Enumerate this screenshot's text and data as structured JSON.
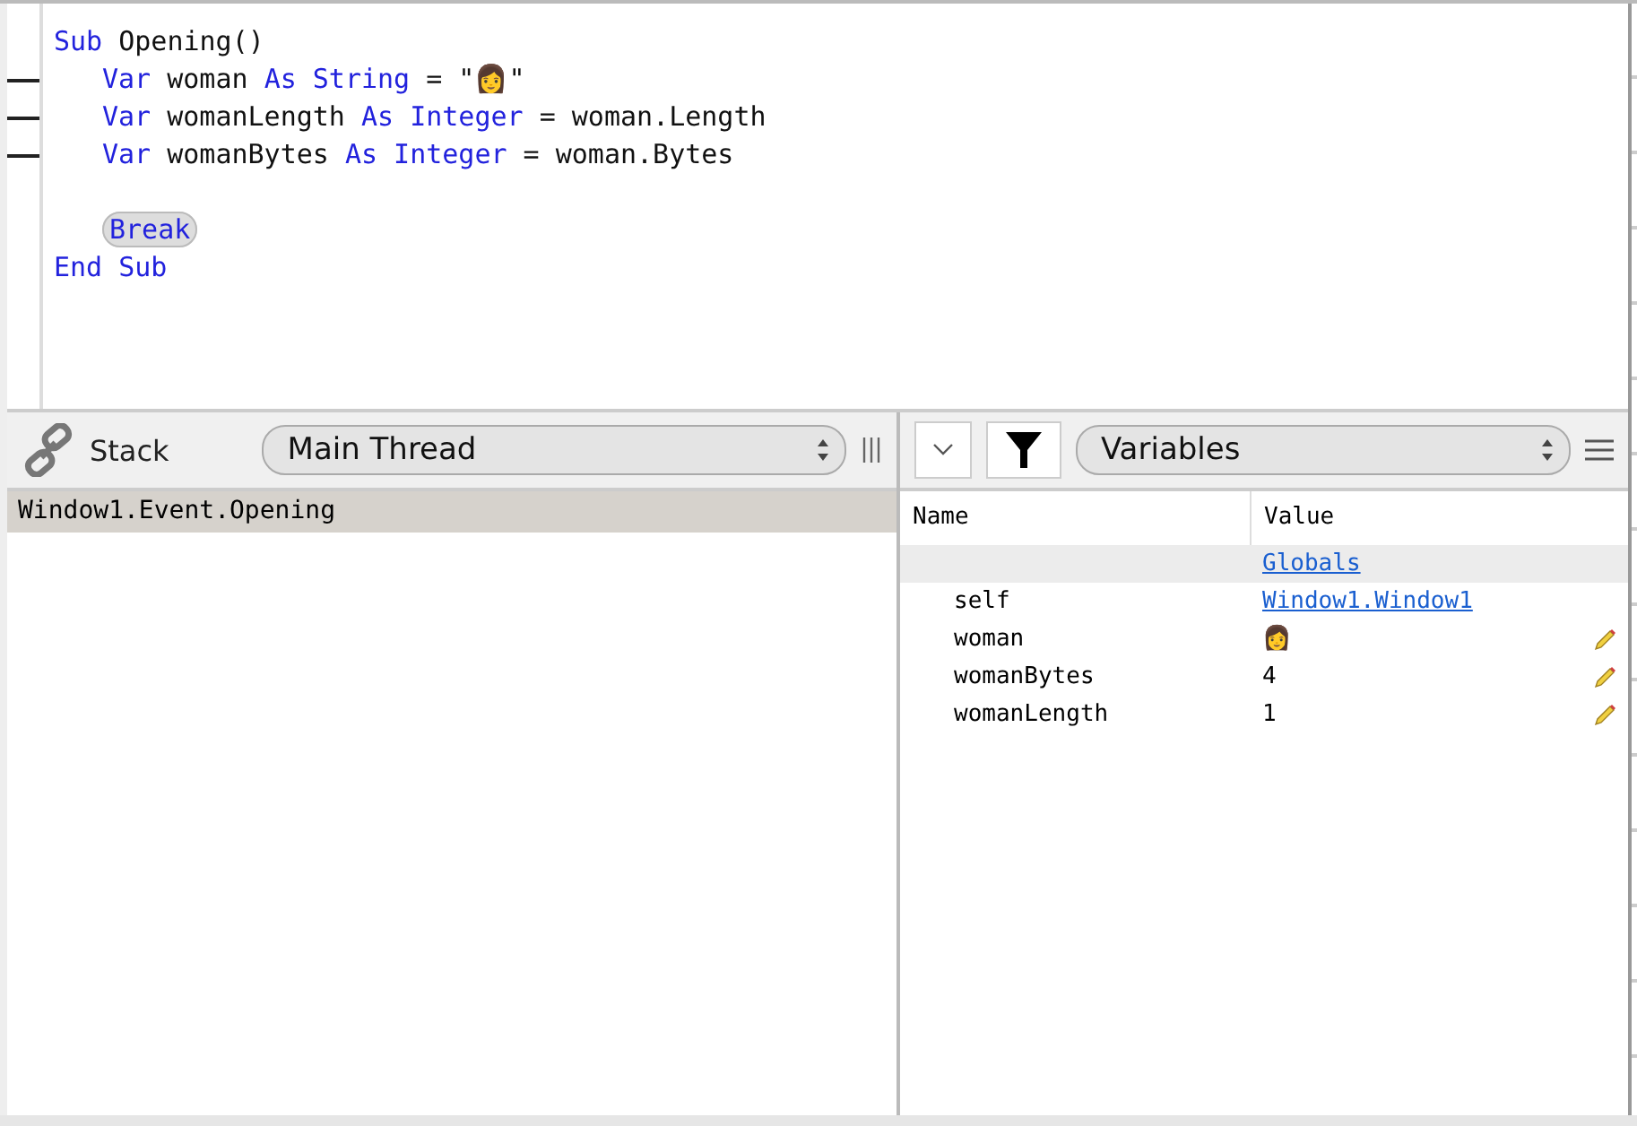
{
  "editor": {
    "lines": [
      {
        "breakpoint": false,
        "indent": false,
        "tokens": [
          {
            "text": "Sub",
            "kind": "keyword"
          },
          {
            "text": " Opening()",
            "kind": "plain"
          }
        ]
      },
      {
        "breakpoint": true,
        "indent": true,
        "tokens": [
          {
            "text": "Var",
            "kind": "keyword"
          },
          {
            "text": " woman ",
            "kind": "plain"
          },
          {
            "text": "As String",
            "kind": "keyword"
          },
          {
            "text": " = \"👩\"",
            "kind": "plain"
          }
        ]
      },
      {
        "breakpoint": true,
        "indent": true,
        "tokens": [
          {
            "text": "Var",
            "kind": "keyword"
          },
          {
            "text": " womanLength ",
            "kind": "plain"
          },
          {
            "text": "As Integer",
            "kind": "keyword"
          },
          {
            "text": " = woman.Length",
            "kind": "plain"
          }
        ]
      },
      {
        "breakpoint": true,
        "indent": true,
        "tokens": [
          {
            "text": "Var",
            "kind": "keyword"
          },
          {
            "text": " womanBytes ",
            "kind": "plain"
          },
          {
            "text": "As Integer",
            "kind": "keyword"
          },
          {
            "text": " = woman.Bytes",
            "kind": "plain"
          }
        ]
      },
      {
        "breakpoint": false,
        "indent": false
      },
      {
        "breakpoint": false,
        "indent": true,
        "tokens": [
          {
            "text": "Break",
            "kind": "pill"
          }
        ]
      },
      {
        "breakpoint": false,
        "indent": false,
        "tokens": [
          {
            "text": "End Sub",
            "kind": "keyword"
          }
        ]
      }
    ]
  },
  "stack": {
    "title": "Stack",
    "thread": "Main Thread",
    "frames": [
      {
        "label": "Window1.Event.Opening",
        "selected": true
      }
    ]
  },
  "variables": {
    "scope": "Variables",
    "columns": [
      "Name",
      "Value"
    ],
    "rows": [
      {
        "value": "Globals",
        "kind": "group",
        "link": true,
        "editable": false
      },
      {
        "name": "self",
        "value": "Window1.Window1",
        "kind": "item",
        "link": true,
        "editable": false
      },
      {
        "name": "woman",
        "value": "👩",
        "kind": "item",
        "link": false,
        "editable": true
      },
      {
        "name": "womanBytes",
        "value": "4",
        "kind": "item",
        "link": false,
        "editable": true
      },
      {
        "name": "womanLength",
        "value": "1",
        "kind": "item",
        "link": false,
        "editable": true
      }
    ]
  }
}
